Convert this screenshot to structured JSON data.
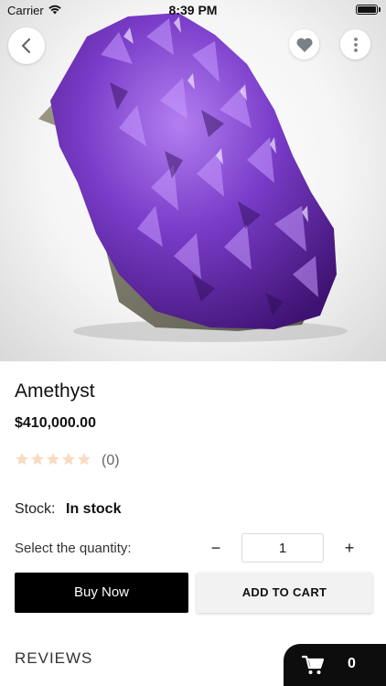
{
  "status_bar": {
    "carrier": "Carrier",
    "time": "8:39 PM"
  },
  "hero": {
    "image_subject": "amethyst-crystal-cluster",
    "accent_color": "#6a2fb5"
  },
  "product": {
    "name": "Amethyst",
    "price": "$410,000.00",
    "rating_stars_filled": 0,
    "rating_stars_total": 5,
    "rating_count": "(0)",
    "stock_label": "Stock:",
    "stock_value": "In stock"
  },
  "quantity": {
    "label": "Select the quantity:",
    "minus": "−",
    "value": "1",
    "plus": "+"
  },
  "actions": {
    "buy_now": "Buy Now",
    "add_to_cart": "ADD TO CART"
  },
  "reviews": {
    "heading": "REVIEWS"
  },
  "cart": {
    "count": "0"
  },
  "colors": {
    "star_empty": "#f6dcc4",
    "buy_button": "#000000",
    "cart_fab": "#0d0d0d"
  },
  "icons": [
    "chevron-left-icon",
    "heart-icon",
    "more-vertical-icon",
    "cart-icon",
    "star-icon",
    "wifi-icon",
    "battery-icon"
  ]
}
